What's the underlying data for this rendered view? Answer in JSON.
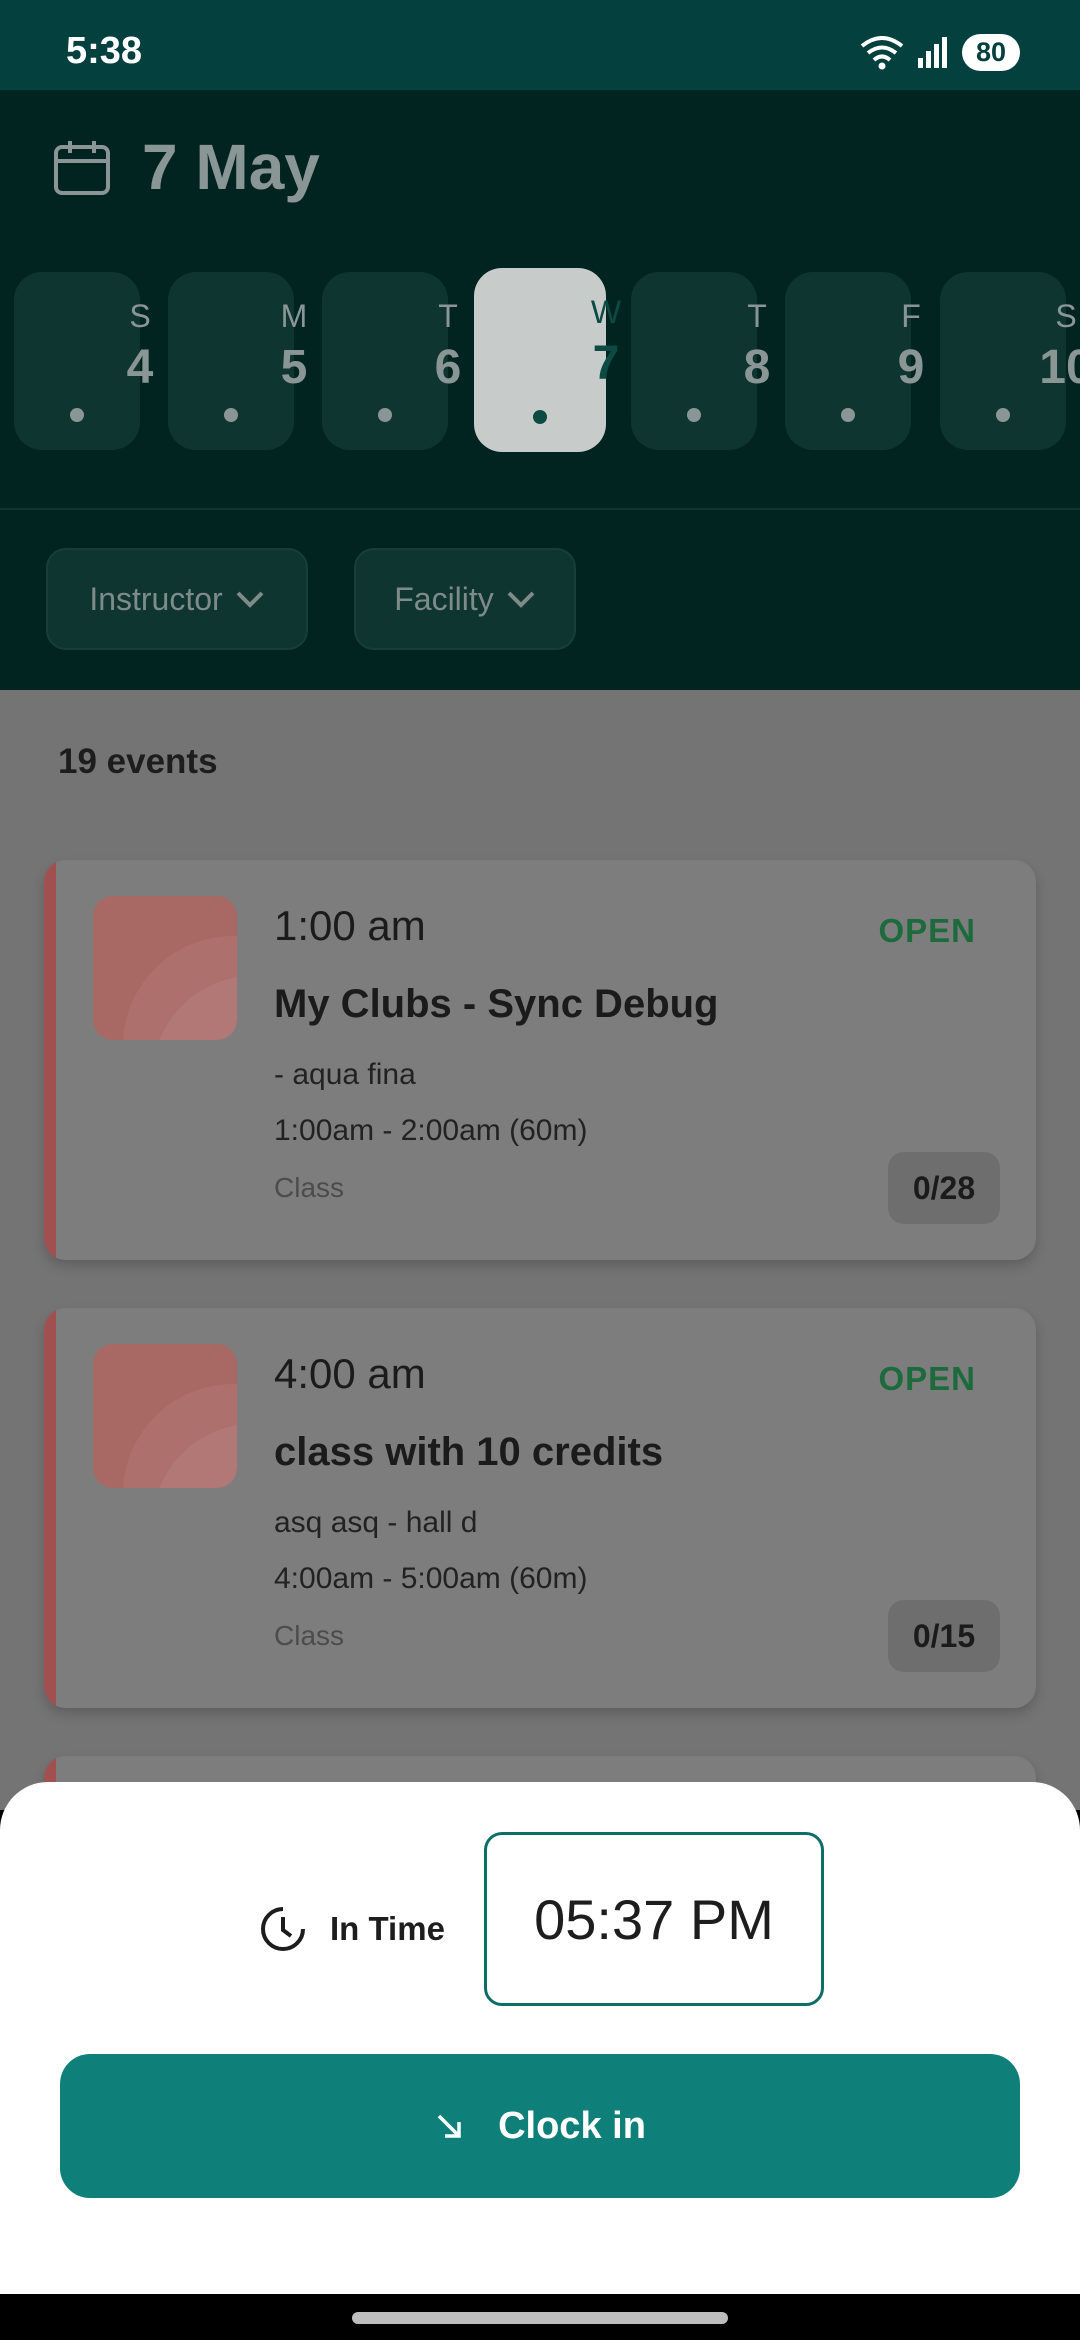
{
  "status_bar": {
    "time": "5:38",
    "battery": "80"
  },
  "header": {
    "date_title": "7 May"
  },
  "days": [
    {
      "letter": "S",
      "num": "4"
    },
    {
      "letter": "M",
      "num": "5"
    },
    {
      "letter": "T",
      "num": "6"
    },
    {
      "letter": "W",
      "num": "7",
      "selected": true
    },
    {
      "letter": "T",
      "num": "8"
    },
    {
      "letter": "F",
      "num": "9"
    },
    {
      "letter": "S",
      "num": "10"
    }
  ],
  "filters": {
    "instructor": "Instructor",
    "facility": "Facility"
  },
  "events_count": "19 events",
  "events": [
    {
      "time": "1:00 am",
      "status": "OPEN",
      "title": "My Clubs - Sync Debug",
      "location": "- aqua fina",
      "range": "1:00am - 2:00am (60m)",
      "type": "Class",
      "capacity": "0/28"
    },
    {
      "time": "4:00 am",
      "status": "OPEN",
      "title": "class with 10 credits",
      "location": "asq asq - hall d",
      "range": "4:00am - 5:00am (60m)",
      "type": "Class",
      "capacity": "0/15"
    }
  ],
  "sheet": {
    "in_time_label": "In Time",
    "in_time_value": "05:37 PM",
    "clock_in_label": "Clock in"
  },
  "colors": {
    "teal": "#0e8079",
    "header": "#04403d",
    "open": "#1d6b3d",
    "accent": "#a0504e"
  }
}
